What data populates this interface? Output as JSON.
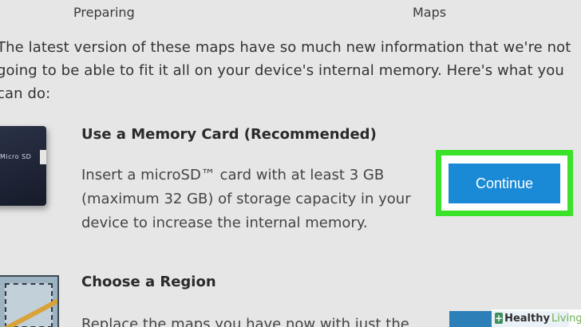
{
  "steps": {
    "preparing": "Preparing",
    "maps": "Maps"
  },
  "intro": "The latest version of these maps have so much new information that we're not going to be able to fit it all on your device's internal memory. Here's what you can do:",
  "options": [
    {
      "title": "Use a Memory Card (Recommended)",
      "description": "Insert a microSD™ card with at least 3 GB (maximum 32 GB) of storage capacity in your device to increase the internal memory.",
      "button": "Continue",
      "card_label": "Micro SD"
    },
    {
      "title": "Choose a Region",
      "description": "Replace the maps you have now with just the"
    }
  ],
  "watermark": {
    "part1": "Healthy",
    "part2": "Living"
  },
  "colors": {
    "accent_button": "#1a8ad6",
    "highlight_border": "#3be22a"
  }
}
